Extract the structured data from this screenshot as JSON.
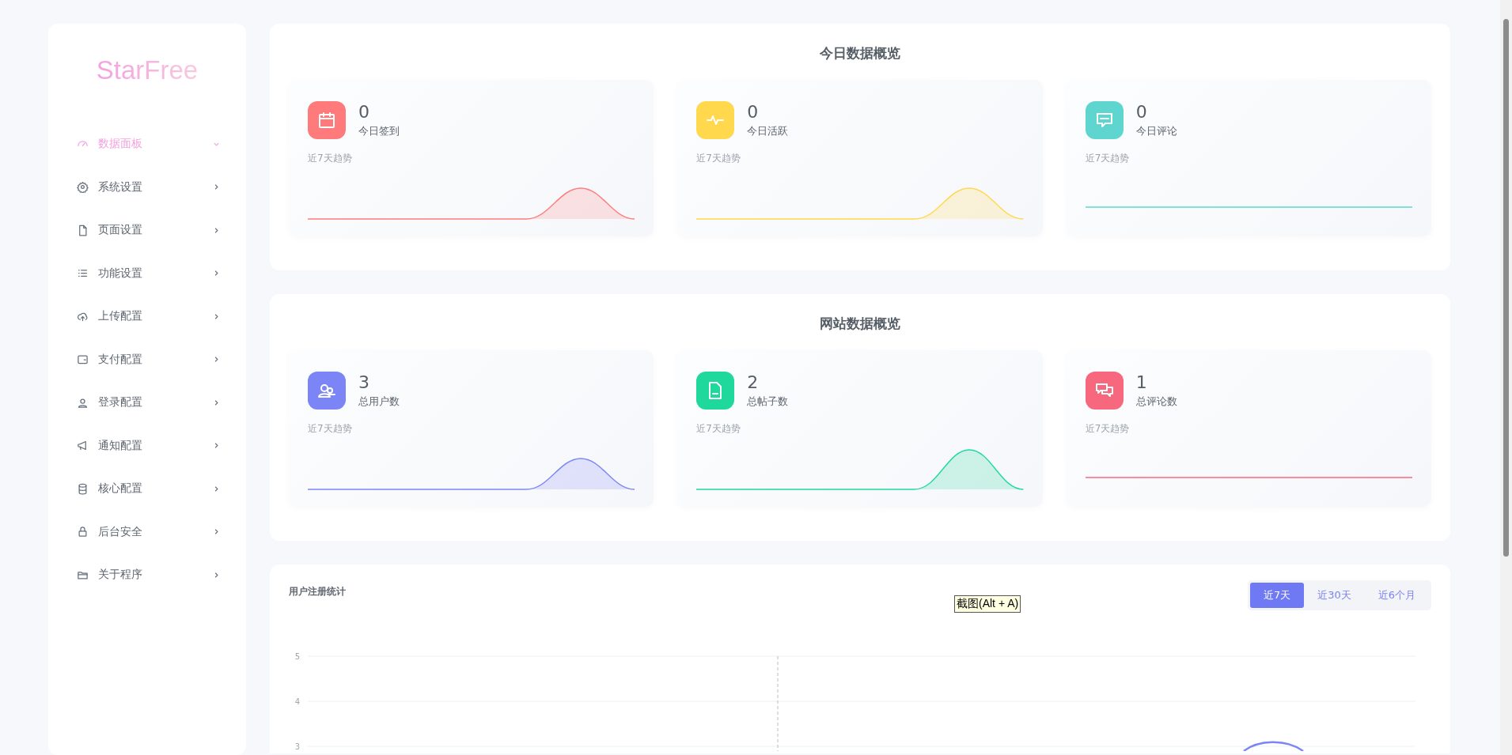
{
  "sidebar": {
    "logo": "StarFree",
    "items": [
      {
        "label": "数据面板",
        "kind": "gauge",
        "selected": true,
        "expanded": true
      },
      {
        "label": "系统设置",
        "kind": "gear",
        "selected": false,
        "expanded": false
      },
      {
        "label": "页面设置",
        "kind": "file",
        "selected": false,
        "expanded": false
      },
      {
        "label": "功能设置",
        "kind": "list",
        "selected": false,
        "expanded": false
      },
      {
        "label": "上传配置",
        "kind": "cloud",
        "selected": false,
        "expanded": false
      },
      {
        "label": "支付配置",
        "kind": "wallet",
        "selected": false,
        "expanded": false
      },
      {
        "label": "登录配置",
        "kind": "user",
        "selected": false,
        "expanded": false
      },
      {
        "label": "通知配置",
        "kind": "megaphone",
        "selected": false,
        "expanded": false
      },
      {
        "label": "核心配置",
        "kind": "database",
        "selected": false,
        "expanded": false
      },
      {
        "label": "后台安全",
        "kind": "lock",
        "selected": false,
        "expanded": false
      },
      {
        "label": "关于程序",
        "kind": "folder",
        "selected": false,
        "expanded": false
      }
    ]
  },
  "sections": [
    {
      "title": "今日数据概览",
      "cards": [
        {
          "value": "0",
          "label": "今日签到",
          "caption": "近7天趋势",
          "kind": "calendar",
          "color": "#ff7b7b"
        },
        {
          "value": "0",
          "label": "今日活跃",
          "caption": "近7天趋势",
          "kind": "pulse",
          "color": "#ffd84d"
        },
        {
          "value": "0",
          "label": "今日评论",
          "caption": "近7天趋势",
          "kind": "comment",
          "color": "#5ed6cf"
        }
      ]
    },
    {
      "title": "网站数据概览",
      "cards": [
        {
          "value": "3",
          "label": "总用户数",
          "caption": "近7天趋势",
          "kind": "users",
          "color": "#7c85f6"
        },
        {
          "value": "2",
          "label": "总帖子数",
          "caption": "近7天趋势",
          "kind": "document",
          "color": "#1fd99c"
        },
        {
          "value": "1",
          "label": "总评论数",
          "caption": "近7天趋势",
          "kind": "chat",
          "color": "#f7687f"
        }
      ]
    }
  ],
  "registration": {
    "title": "用户注册统计",
    "tabs": [
      {
        "label": "近7天",
        "selected": true
      },
      {
        "label": "近30天",
        "selected": false
      },
      {
        "label": "近6个月",
        "selected": false
      }
    ],
    "y_axis_labels": [
      "5",
      "4",
      "3"
    ]
  },
  "tooltip": "截图(Alt + A)"
}
